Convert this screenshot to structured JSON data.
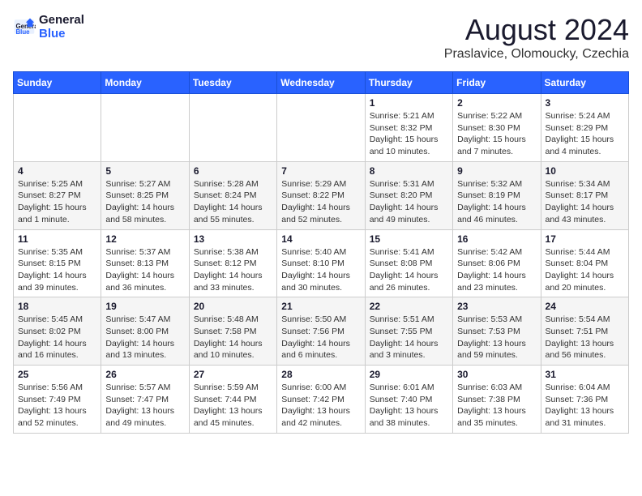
{
  "header": {
    "logo_line1": "General",
    "logo_line2": "Blue",
    "month": "August 2024",
    "location": "Praslavice, Olomoucky, Czechia"
  },
  "weekdays": [
    "Sunday",
    "Monday",
    "Tuesday",
    "Wednesday",
    "Thursday",
    "Friday",
    "Saturday"
  ],
  "weeks": [
    [
      {
        "day": "",
        "info": ""
      },
      {
        "day": "",
        "info": ""
      },
      {
        "day": "",
        "info": ""
      },
      {
        "day": "",
        "info": ""
      },
      {
        "day": "1",
        "info": "Sunrise: 5:21 AM\nSunset: 8:32 PM\nDaylight: 15 hours\nand 10 minutes."
      },
      {
        "day": "2",
        "info": "Sunrise: 5:22 AM\nSunset: 8:30 PM\nDaylight: 15 hours\nand 7 minutes."
      },
      {
        "day": "3",
        "info": "Sunrise: 5:24 AM\nSunset: 8:29 PM\nDaylight: 15 hours\nand 4 minutes."
      }
    ],
    [
      {
        "day": "4",
        "info": "Sunrise: 5:25 AM\nSunset: 8:27 PM\nDaylight: 15 hours\nand 1 minute."
      },
      {
        "day": "5",
        "info": "Sunrise: 5:27 AM\nSunset: 8:25 PM\nDaylight: 14 hours\nand 58 minutes."
      },
      {
        "day": "6",
        "info": "Sunrise: 5:28 AM\nSunset: 8:24 PM\nDaylight: 14 hours\nand 55 minutes."
      },
      {
        "day": "7",
        "info": "Sunrise: 5:29 AM\nSunset: 8:22 PM\nDaylight: 14 hours\nand 52 minutes."
      },
      {
        "day": "8",
        "info": "Sunrise: 5:31 AM\nSunset: 8:20 PM\nDaylight: 14 hours\nand 49 minutes."
      },
      {
        "day": "9",
        "info": "Sunrise: 5:32 AM\nSunset: 8:19 PM\nDaylight: 14 hours\nand 46 minutes."
      },
      {
        "day": "10",
        "info": "Sunrise: 5:34 AM\nSunset: 8:17 PM\nDaylight: 14 hours\nand 43 minutes."
      }
    ],
    [
      {
        "day": "11",
        "info": "Sunrise: 5:35 AM\nSunset: 8:15 PM\nDaylight: 14 hours\nand 39 minutes."
      },
      {
        "day": "12",
        "info": "Sunrise: 5:37 AM\nSunset: 8:13 PM\nDaylight: 14 hours\nand 36 minutes."
      },
      {
        "day": "13",
        "info": "Sunrise: 5:38 AM\nSunset: 8:12 PM\nDaylight: 14 hours\nand 33 minutes."
      },
      {
        "day": "14",
        "info": "Sunrise: 5:40 AM\nSunset: 8:10 PM\nDaylight: 14 hours\nand 30 minutes."
      },
      {
        "day": "15",
        "info": "Sunrise: 5:41 AM\nSunset: 8:08 PM\nDaylight: 14 hours\nand 26 minutes."
      },
      {
        "day": "16",
        "info": "Sunrise: 5:42 AM\nSunset: 8:06 PM\nDaylight: 14 hours\nand 23 minutes."
      },
      {
        "day": "17",
        "info": "Sunrise: 5:44 AM\nSunset: 8:04 PM\nDaylight: 14 hours\nand 20 minutes."
      }
    ],
    [
      {
        "day": "18",
        "info": "Sunrise: 5:45 AM\nSunset: 8:02 PM\nDaylight: 14 hours\nand 16 minutes."
      },
      {
        "day": "19",
        "info": "Sunrise: 5:47 AM\nSunset: 8:00 PM\nDaylight: 14 hours\nand 13 minutes."
      },
      {
        "day": "20",
        "info": "Sunrise: 5:48 AM\nSunset: 7:58 PM\nDaylight: 14 hours\nand 10 minutes."
      },
      {
        "day": "21",
        "info": "Sunrise: 5:50 AM\nSunset: 7:56 PM\nDaylight: 14 hours\nand 6 minutes."
      },
      {
        "day": "22",
        "info": "Sunrise: 5:51 AM\nSunset: 7:55 PM\nDaylight: 14 hours\nand 3 minutes."
      },
      {
        "day": "23",
        "info": "Sunrise: 5:53 AM\nSunset: 7:53 PM\nDaylight: 13 hours\nand 59 minutes."
      },
      {
        "day": "24",
        "info": "Sunrise: 5:54 AM\nSunset: 7:51 PM\nDaylight: 13 hours\nand 56 minutes."
      }
    ],
    [
      {
        "day": "25",
        "info": "Sunrise: 5:56 AM\nSunset: 7:49 PM\nDaylight: 13 hours\nand 52 minutes."
      },
      {
        "day": "26",
        "info": "Sunrise: 5:57 AM\nSunset: 7:47 PM\nDaylight: 13 hours\nand 49 minutes."
      },
      {
        "day": "27",
        "info": "Sunrise: 5:59 AM\nSunset: 7:44 PM\nDaylight: 13 hours\nand 45 minutes."
      },
      {
        "day": "28",
        "info": "Sunrise: 6:00 AM\nSunset: 7:42 PM\nDaylight: 13 hours\nand 42 minutes."
      },
      {
        "day": "29",
        "info": "Sunrise: 6:01 AM\nSunset: 7:40 PM\nDaylight: 13 hours\nand 38 minutes."
      },
      {
        "day": "30",
        "info": "Sunrise: 6:03 AM\nSunset: 7:38 PM\nDaylight: 13 hours\nand 35 minutes."
      },
      {
        "day": "31",
        "info": "Sunrise: 6:04 AM\nSunset: 7:36 PM\nDaylight: 13 hours\nand 31 minutes."
      }
    ]
  ]
}
